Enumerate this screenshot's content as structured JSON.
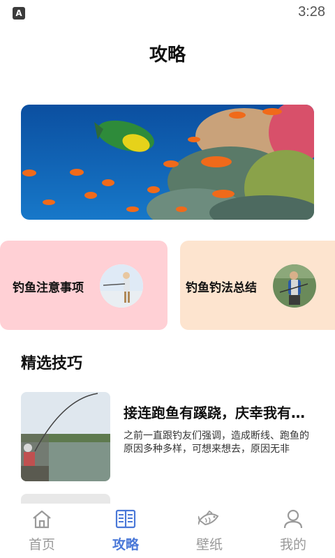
{
  "status_bar": {
    "app_icon_letter": "A",
    "time": "3:28"
  },
  "header": {
    "title": "攻略"
  },
  "categories": [
    {
      "label": "钓鱼注意事项",
      "color": "#ffd0d5"
    },
    {
      "label": "钓鱼钓法总结",
      "color": "#fde4cf"
    }
  ],
  "section": {
    "title": "精选技巧"
  },
  "articles": [
    {
      "title": "接连跑鱼有蹊跷，庆幸我有…",
      "excerpt": "之前一直跟钓友们强调，造成断线、跑鱼的原因多种多样，可想来想去，原因无非"
    }
  ],
  "tabs": [
    {
      "label": "首页",
      "icon": "home-icon",
      "active": false
    },
    {
      "label": "攻略",
      "icon": "book-icon",
      "active": true
    },
    {
      "label": "壁纸",
      "icon": "fish-icon",
      "active": false
    },
    {
      "label": "我的",
      "icon": "user-icon",
      "active": false
    }
  ],
  "colors": {
    "accent": "#4a78d8",
    "inactive": "#9a9a9a"
  }
}
